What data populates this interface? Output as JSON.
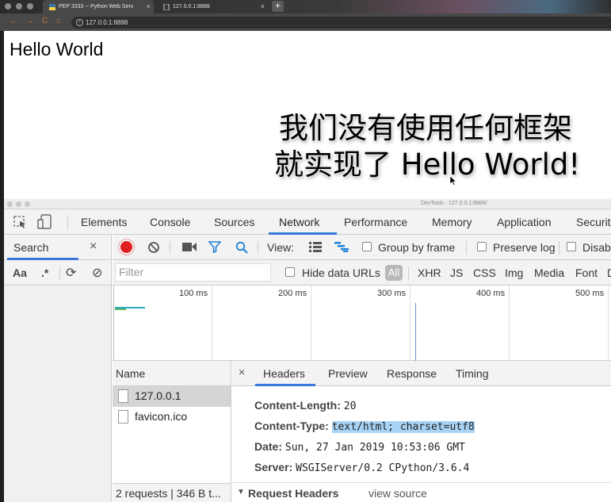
{
  "browser": {
    "tabs": [
      {
        "title": "PEP 3333 -- Python Web Serv",
        "close": "×"
      },
      {
        "title": "127.0.0.1:8888",
        "close": "×"
      }
    ],
    "new_tab": "+",
    "nav": {
      "back": "←",
      "forward": "→",
      "reload": "C",
      "home": "⌂"
    },
    "url": "127.0.0.1:8888",
    "info_glyph": "i"
  },
  "page": {
    "heading": "Hello World",
    "subtitle_line1": "我们没有使用任何框架",
    "subtitle_line2": "就实现了 Hello World!"
  },
  "devtools": {
    "window_title": "DevTools - 127.0.0.1:8888/",
    "tabs": [
      "Elements",
      "Console",
      "Sources",
      "Network",
      "Performance",
      "Memory",
      "Application",
      "Securit"
    ],
    "selected_tab": "Network",
    "search": {
      "label": "Search",
      "close": "×",
      "tools": [
        "Aa",
        ".*",
        "⟳",
        "⊘"
      ]
    },
    "network_toolbar": {
      "view_label": "View:",
      "group_by_frame": "Group by frame",
      "preserve_log": "Preserve log",
      "disable_cache": "Disabl"
    },
    "filter": {
      "placeholder": "Filter",
      "hide_data_urls": "Hide data URLs",
      "types": [
        "All",
        "XHR",
        "JS",
        "CSS",
        "Img",
        "Media",
        "Font",
        "D"
      ]
    },
    "timeline": {
      "ticks": [
        "100 ms",
        "200 ms",
        "300 ms",
        "400 ms",
        "500 ms"
      ]
    },
    "name_column": "Name",
    "requests": [
      {
        "name": "127.0.0.1"
      },
      {
        "name": "favicon.ico"
      }
    ],
    "status": "2 requests | 346 B t...",
    "detail_tabs": [
      "Headers",
      "Preview",
      "Response",
      "Timing"
    ],
    "detail_close": "×",
    "headers": [
      {
        "name": "Content-Length:",
        "value": "20"
      },
      {
        "name": "Content-Type:",
        "value": "text/html; charset=utf8"
      },
      {
        "name": "Date:",
        "value": "Sun, 27 Jan 2019 10:53:06 GMT"
      },
      {
        "name": "Server:",
        "value": "WSGIServer/0.2 CPython/3.6.4"
      }
    ],
    "request_headers": {
      "title": "Request Headers",
      "toggle": "▼",
      "view_source": "view source"
    }
  },
  "colors": {
    "accent": "#3879d9",
    "record": "#e02020",
    "highlight": "#a9d3f5"
  }
}
